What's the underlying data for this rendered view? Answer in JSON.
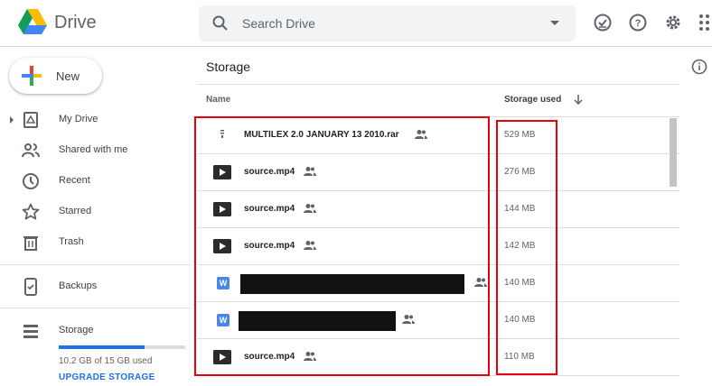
{
  "header": {
    "app_name": "Drive",
    "search_placeholder": "Search Drive"
  },
  "sidebar": {
    "new_label": "New",
    "items": [
      {
        "label": "My Drive",
        "icon": "my-drive-icon"
      },
      {
        "label": "Shared with me",
        "icon": "people-icon"
      },
      {
        "label": "Recent",
        "icon": "clock-icon"
      },
      {
        "label": "Starred",
        "icon": "star-icon"
      },
      {
        "label": "Trash",
        "icon": "trash-icon"
      },
      {
        "label": "Backups",
        "icon": "backup-phone-icon"
      },
      {
        "label": "Storage",
        "icon": "storage-icon"
      }
    ],
    "storage_used_fraction": 0.68,
    "storage_text": "10.2 GB of 15 GB used",
    "upgrade_label": "UPGRADE STORAGE"
  },
  "main": {
    "title": "Storage",
    "col_name": "Name",
    "col_storage": "Storage used",
    "rows": [
      {
        "name": "MULTILEX 2.0 JANUARY 13 2010.rar",
        "size": "529 MB",
        "type": "archive",
        "shared": true
      },
      {
        "name": "source.mp4",
        "size": "276 MB",
        "type": "video",
        "shared": true
      },
      {
        "name": "source.mp4",
        "size": "144 MB",
        "type": "video",
        "shared": true
      },
      {
        "name": "source.mp4",
        "size": "142 MB",
        "type": "video",
        "shared": true
      },
      {
        "name": "",
        "size": "140 MB",
        "type": "word",
        "shared": true
      },
      {
        "name": "",
        "size": "140 MB",
        "type": "word",
        "shared": true
      },
      {
        "name": "source.mp4",
        "size": "110 MB",
        "type": "video",
        "shared": true
      }
    ],
    "word_icon_letter": "W"
  },
  "colors": {
    "accent": "#1a73e8",
    "highlight_box": "#e8000d"
  }
}
